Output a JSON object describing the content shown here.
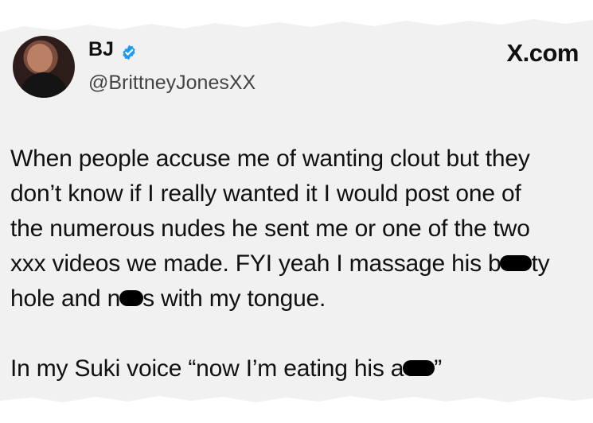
{
  "profile": {
    "name": "BJ",
    "handle": "@BrittneyJonesXX"
  },
  "site_logo": "X.com",
  "tweet": {
    "line1": "When people accuse me of wanting clout but they",
    "line2": "don’t know if I really wanted it I would post one of",
    "line3": "the numerous nudes he sent me or one of the two",
    "line4_part1": "xxx videos we made. FYI yeah I massage his b",
    "line4_part2": "ty",
    "line5_part1": "hole and n",
    "line5_part2": "s with my tongue.",
    "line6_part1": "In my Suki voice “now I’m eating his a",
    "line6_part2": "”"
  },
  "colors": {
    "paper": "#f1f1f1",
    "text": "#111111",
    "handle": "#444444",
    "verified": "#1d9bf0",
    "redaction": "#000000"
  },
  "icons": {
    "verified": "verified-badge-icon"
  }
}
